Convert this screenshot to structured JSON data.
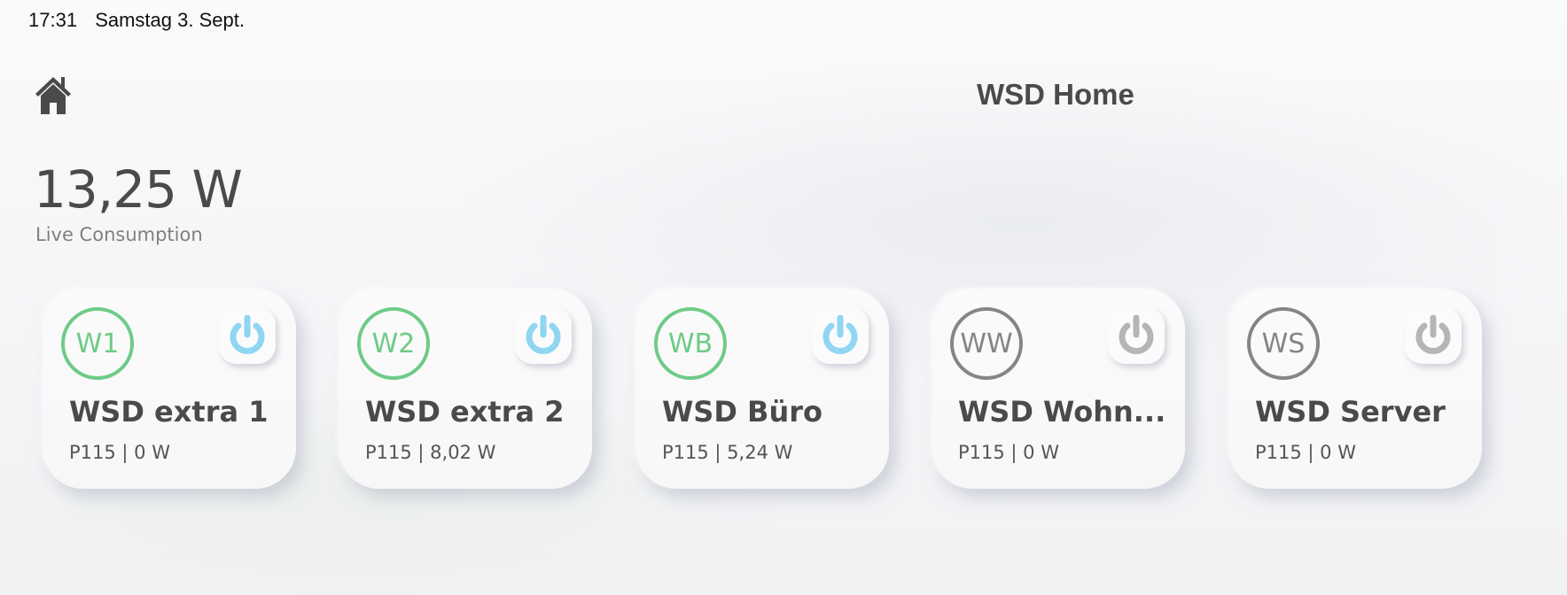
{
  "status_bar": {
    "time": "17:31",
    "date": "Samstag 3. Sept."
  },
  "header": {
    "title": "WSD Home",
    "home_icon": "home-icon"
  },
  "consumption": {
    "value": "13,25 W",
    "label": "Live Consumption"
  },
  "colors": {
    "on_green": "#6ecb86",
    "power_on_blue": "#8fd6f2",
    "off_gray": "#858585",
    "power_off_gray": "#b5b5b5",
    "text": "#4a4a4a"
  },
  "devices": [
    {
      "initials": "W1",
      "name": "WSD extra 1",
      "detail": "P115 | 0 W",
      "state": "on",
      "power_icon": "power-icon"
    },
    {
      "initials": "W2",
      "name": "WSD extra 2",
      "detail": "P115 | 8,02 W",
      "state": "on",
      "power_icon": "power-icon"
    },
    {
      "initials": "WB",
      "name": "WSD Büro",
      "detail": "P115 | 5,24 W",
      "state": "on",
      "power_icon": "power-icon"
    },
    {
      "initials": "WW",
      "name": "WSD Wohn...",
      "detail": "P115 | 0 W",
      "state": "off",
      "power_icon": "power-icon"
    },
    {
      "initials": "WS",
      "name": "WSD Server",
      "detail": "P115 | 0 W",
      "state": "off",
      "power_icon": "power-icon"
    }
  ]
}
